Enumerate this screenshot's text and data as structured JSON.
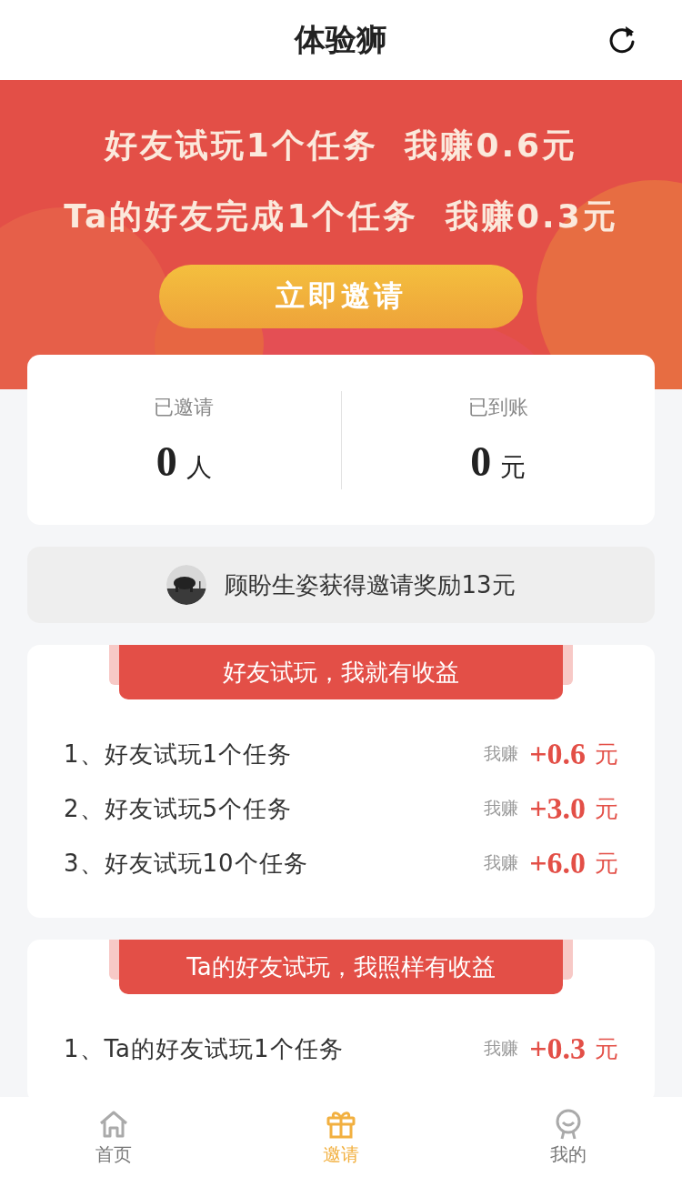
{
  "header": {
    "title": "体验狮"
  },
  "banner": {
    "lines": [
      "好友试玩1个任务 我赚0.6元",
      "Ta的好友完成1个任务 我赚0.3元"
    ],
    "button": "立即邀请"
  },
  "stats": [
    {
      "label": "已邀请",
      "value": "0",
      "unit": "人"
    },
    {
      "label": "已到账",
      "value": "0",
      "unit": "元"
    }
  ],
  "notice": {
    "text": "顾盼生姿获得邀请奖励13元"
  },
  "sections": [
    {
      "title": "好友试玩，我就有收益",
      "rows": [
        {
          "task": "1、好友试玩1个任务",
          "earn_label": "我赚",
          "amount": "+0.6",
          "unit": "元"
        },
        {
          "task": "2、好友试玩5个任务",
          "earn_label": "我赚",
          "amount": "+3.0",
          "unit": "元"
        },
        {
          "task": "3、好友试玩10个任务",
          "earn_label": "我赚",
          "amount": "+6.0",
          "unit": "元"
        }
      ]
    },
    {
      "title": "Ta的好友试玩，我照样有收益",
      "rows": [
        {
          "task": "1、Ta的好友试玩1个任务",
          "earn_label": "我赚",
          "amount": "+0.3",
          "unit": "元"
        }
      ]
    }
  ],
  "tabs": [
    {
      "label": "首页",
      "kind": "home",
      "selected": false
    },
    {
      "label": "邀请",
      "kind": "gift",
      "selected": true
    },
    {
      "label": "我的",
      "kind": "person",
      "selected": false
    }
  ]
}
